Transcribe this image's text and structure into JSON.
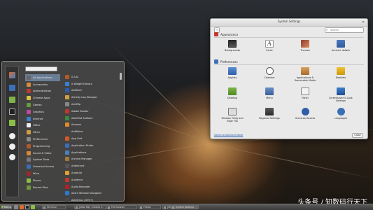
{
  "settings": {
    "title": "System Settings",
    "search_placeholder": "Search",
    "appearance": {
      "heading": "Appearance",
      "items": [
        "Backgrounds",
        "Fonts",
        "Themes",
        "Account details"
      ]
    },
    "preferences": {
      "heading": "Preferences",
      "items": [
        "Applets",
        "Calendar",
        "Applications & Removable Media",
        "Desklets",
        "Desktop",
        "Menu",
        "Panel",
        "Screensaver & Lock Settings",
        "Window Tiling and Edge Flip",
        "Regional Settings",
        "Universal Access",
        "Languages"
      ]
    },
    "footer_link": "Switch to Advanced Mode",
    "close_button": "Close"
  },
  "menu": {
    "categories": [
      "All Applications",
      "Accessories",
      "Administration",
      "Chinese Apps",
      "Games",
      "Graphics",
      "Internet",
      "Office",
      "Other",
      "Preferences",
      "Programming",
      "Sound & Video",
      "System Tools",
      "Universal Access",
      "Wine",
      "Places",
      "Recent Files"
    ],
    "applications": [
      "0 A.D.",
      "A Widget Factory",
      "AbiWord",
      "Activity Log Manager",
      "AcidRip",
      "Adobe Reader",
      "AisleRiot Solitaire",
      "Amazon",
      "AntiMicro",
      "App Grid",
      "Application Finder",
      "Applications",
      "Archive Manager",
      "Ardentryst",
      "Audacity",
      "Audience",
      "Audio Recorder",
      "Avant Window Navigator",
      "Avidemux (GTK+)"
    ]
  },
  "taskbar": {
    "menu_label": "Menu",
    "tasks": [
      "Terminal",
      "[New Tab] - Mozilla F...",
      "File Browser",
      "Firefox",
      "[Menu]",
      "System Settings"
    ]
  },
  "watermark": "头条号 / 知数码行天下",
  "colors": {
    "accent_selected": "#6a7d95",
    "settings_bg": "#e9e9e9",
    "menu_bg": "#464646"
  }
}
